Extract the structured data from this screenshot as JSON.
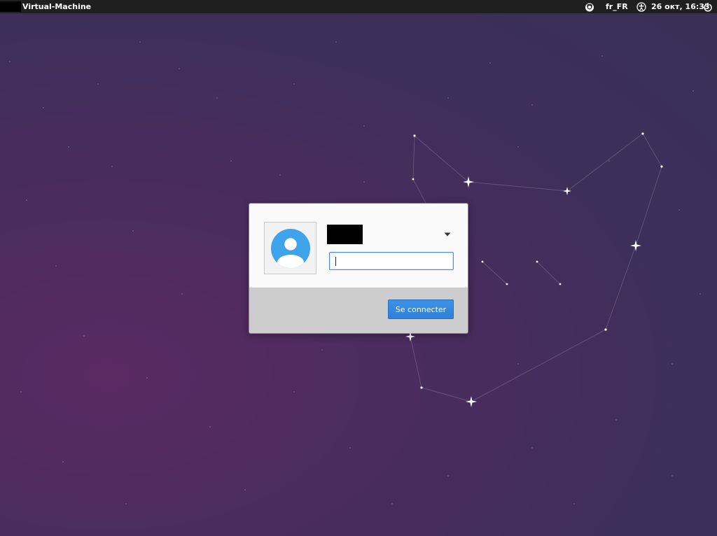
{
  "panel": {
    "hostname": "Virtual-Machine",
    "keyboard_layout": "fr_FR",
    "clock": "26 окт, 16:33",
    "icons": {
      "keyboard_indicator": "keyboard-indicator-icon",
      "accessibility": "accessibility-icon",
      "power": "power-icon"
    }
  },
  "login": {
    "password_placeholder": "",
    "password_value": "",
    "login_label": "Se connecter",
    "avatar_icon": "user-avatar-icon",
    "dropdown_icon": "caret-down-icon"
  },
  "colors": {
    "panel_bg": "#1f1f1f",
    "desktop_bg": "#4a2c5e",
    "accent": "#3d92e8",
    "avatar_blue": "#3ea3e8"
  }
}
